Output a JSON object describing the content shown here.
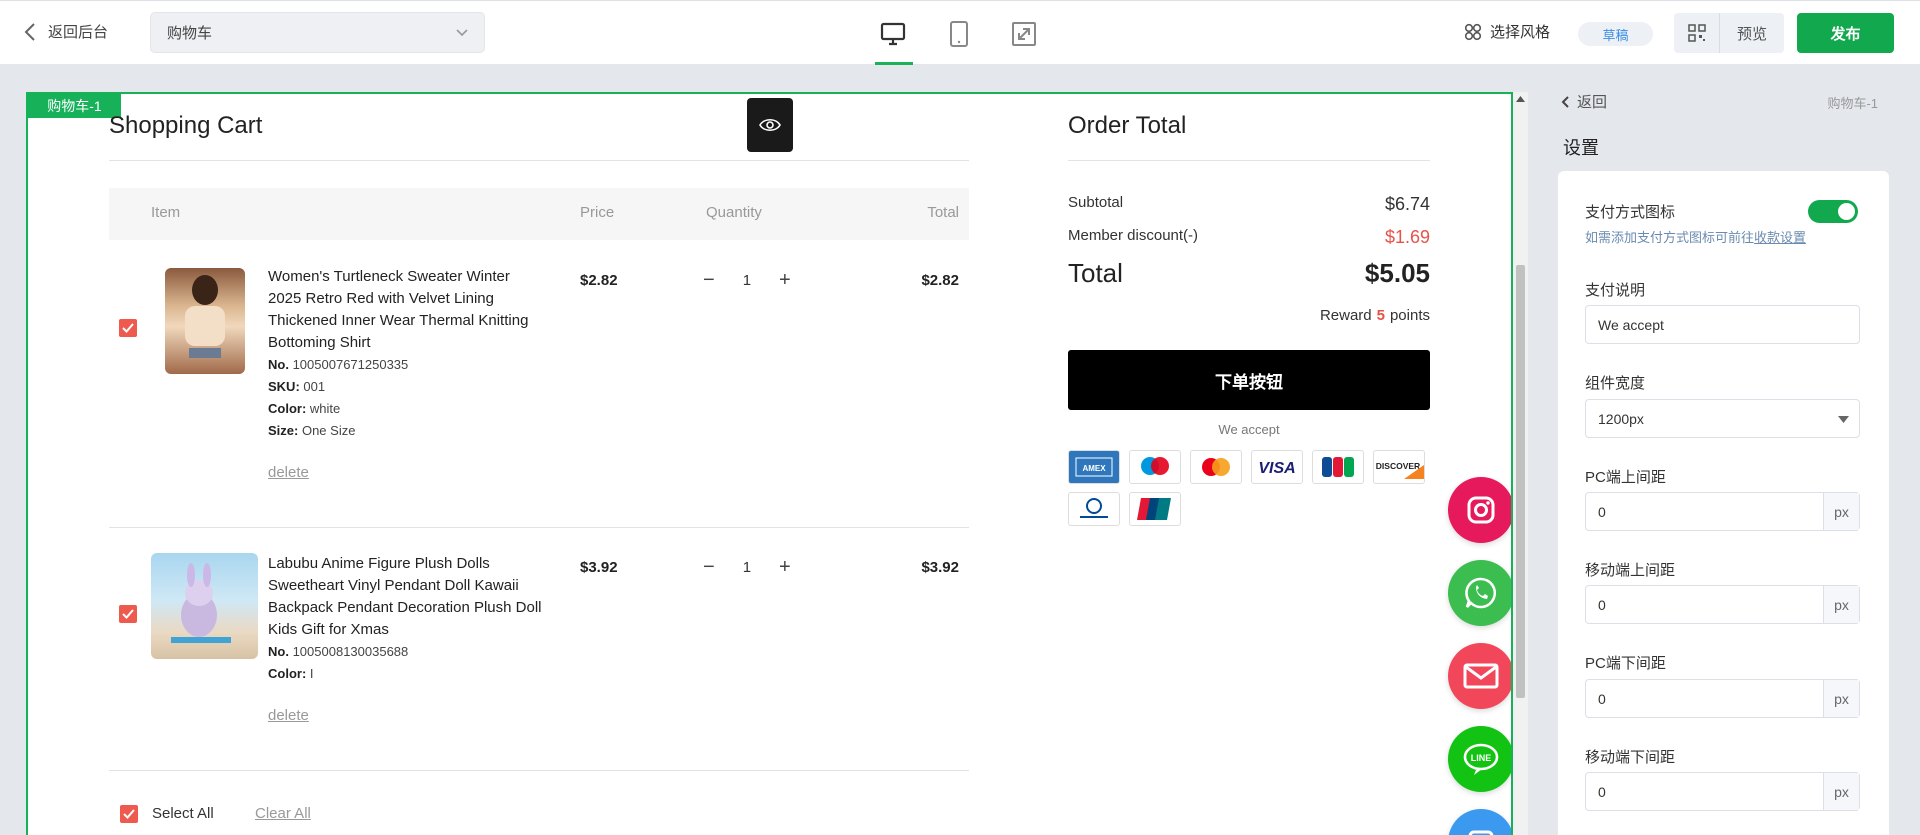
{
  "topbar": {
    "back_label": "返回后台",
    "page_select_value": "购物车",
    "style_label": "选择风格",
    "draft_label": "草稿",
    "preview_label": "预览",
    "publish_label": "发布"
  },
  "canvas": {
    "component_tag": "购物车-1",
    "cart": {
      "title": "Shopping Cart",
      "columns": {
        "item": "Item",
        "price": "Price",
        "quantity": "Quantity",
        "total": "Total"
      },
      "items": [
        {
          "name": "Women's Turtleneck Sweater Winter 2025 Retro Red with Velvet Lining Thickened Inner Wear Thermal Knitting Bottoming Shirt",
          "no_label": "No.",
          "no": "1005007671250335",
          "sku_label": "SKU:",
          "sku": "001",
          "color_label": "Color:",
          "color": "white",
          "size_label": "Size:",
          "size": "One Size",
          "delete_label": "delete",
          "price": "$2.82",
          "quantity": "1",
          "total": "$2.82"
        },
        {
          "name": "Labubu Anime Figure Plush Dolls Sweetheart Vinyl Pendant Doll Kawaii Backpack Pendant Decoration Plush Doll Kids Gift for Xmas",
          "no_label": "No.",
          "no": "1005008130035688",
          "color_label": "Color:",
          "color": "I",
          "delete_label": "delete",
          "price": "$3.92",
          "quantity": "1",
          "total": "$3.92"
        }
      ],
      "select_all_label": "Select All",
      "clear_all_label": "Clear All"
    },
    "order": {
      "title": "Order Total",
      "subtotal_label": "Subtotal",
      "subtotal": "$6.74",
      "discount_label": "Member discount(-)",
      "discount": "$1.69",
      "total_label": "Total",
      "total": "$5.05",
      "reward_prefix": "Reward",
      "reward_points": "5",
      "reward_suffix": "points",
      "order_button": "下单按钮",
      "we_accept": "We accept",
      "payment_icons": [
        "amex-icon",
        "maestro-icon",
        "mastercard-icon",
        "visa-icon",
        "jcb-icon",
        "discover-icon",
        "diners-club-icon",
        "unionpay-icon"
      ]
    },
    "social_icons": [
      "instagram-icon",
      "whatsapp-icon",
      "email-icon",
      "line-icon",
      "messenger-icon"
    ]
  },
  "settings": {
    "back_label": "返回",
    "component_name": "购物车-1",
    "section_title": "设置",
    "payment_icon_label": "支付方式图标",
    "payment_icon_on": true,
    "payment_hint_prefix": "如需添加支付方式图标可前往",
    "payment_hint_link": "收款设置",
    "payment_desc_label": "支付说明",
    "payment_desc_value": "We accept",
    "width_label": "组件宽度",
    "width_value": "1200px",
    "pc_top_label": "PC端上间距",
    "pc_top_value": "0",
    "mobile_top_label": "移动端上间距",
    "mobile_top_value": "0",
    "pc_bottom_label": "PC端下间距",
    "pc_bottom_value": "0",
    "mobile_bottom_label": "移动端下间距",
    "mobile_bottom_value": "0",
    "unit": "px"
  },
  "colors": {
    "accent": "#12a94e",
    "checkbox": "#ef5a4e",
    "discount": "#e8514a"
  }
}
